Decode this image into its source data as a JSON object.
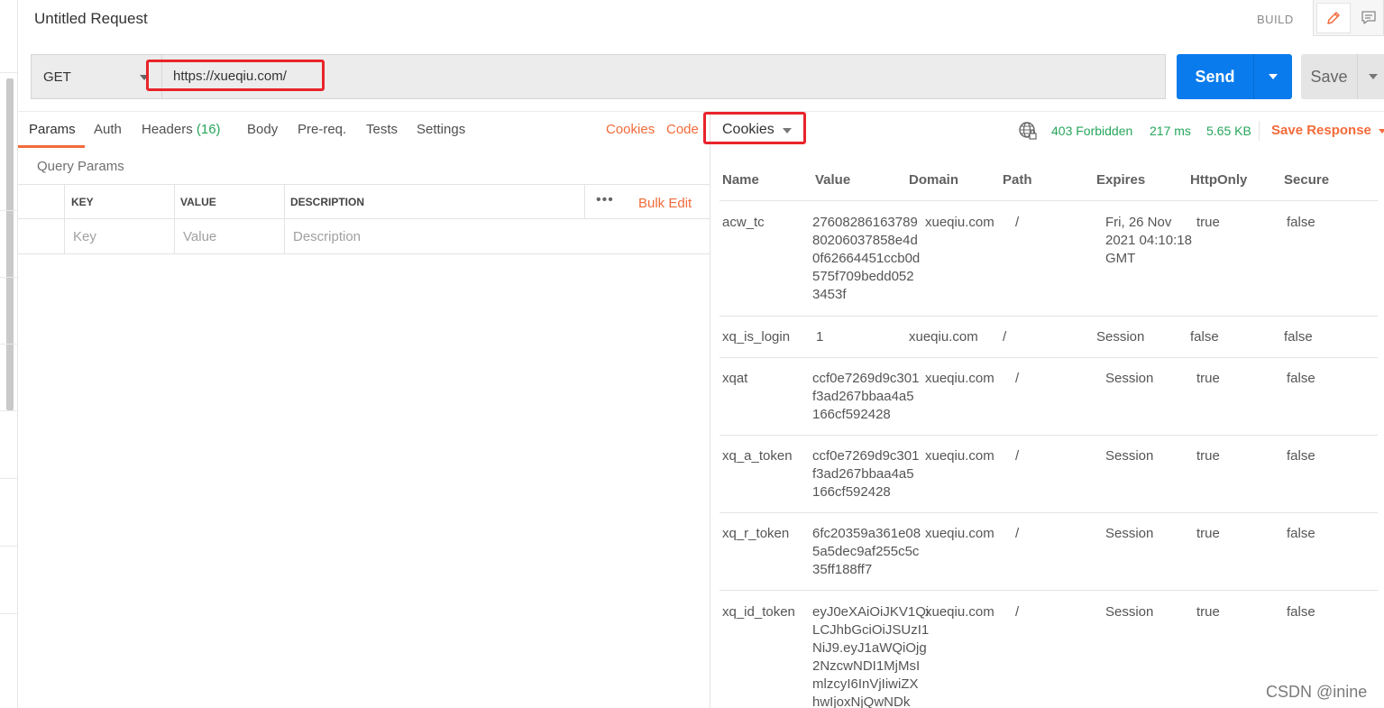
{
  "header": {
    "title": "Untitled Request",
    "build_label": "BUILD"
  },
  "request": {
    "method": "GET",
    "url": "https://xueqiu.com/",
    "send_label": "Send",
    "save_label": "Save"
  },
  "request_tabs": {
    "params": "Params",
    "auth": "Auth",
    "headers": "Headers",
    "headers_count": "(16)",
    "body": "Body",
    "prereq": "Pre-req.",
    "tests": "Tests",
    "settings": "Settings",
    "cookies_link": "Cookies",
    "code_link": "Code"
  },
  "query_params": {
    "title": "Query Params",
    "columns": [
      "KEY",
      "VALUE",
      "DESCRIPTION"
    ],
    "placeholders": [
      "Key",
      "Value",
      "Description"
    ],
    "bulk_edit": "Bulk Edit"
  },
  "response": {
    "tab_label": "Cookies",
    "status": "403 Forbidden",
    "time": "217 ms",
    "size": "5.65 KB",
    "save_response": "Save Response",
    "accent_color": "#f26b3a",
    "status_color": "#26a65b"
  },
  "cookies": {
    "columns": [
      "Name",
      "Value",
      "Domain",
      "Path",
      "Expires",
      "HttpOnly",
      "Secure"
    ],
    "rows": [
      {
        "name": "acw_tc",
        "value": "27608286163789\n80206037858e4d\n0f62664451ccb0d\n575f709bedd052\n3453f",
        "domain": "xueqiu.com",
        "path": "/",
        "expires": "Fri, 26 Nov\n2021 04:10:18\nGMT",
        "httponly": "true",
        "secure": "false"
      },
      {
        "name": "xq_is_login",
        "value": "1",
        "domain": "xueqiu.com",
        "path": "/",
        "expires": "Session",
        "httponly": "false",
        "secure": "false"
      },
      {
        "name": "xqat",
        "value": "ccf0e7269d9c301\nf3ad267bbaa4a5\n166cf592428",
        "domain": "xueqiu.com",
        "path": "/",
        "expires": "Session",
        "httponly": "true",
        "secure": "false"
      },
      {
        "name": "xq_a_token",
        "value": "ccf0e7269d9c301\nf3ad267bbaa4a5\n166cf592428",
        "domain": "xueqiu.com",
        "path": "/",
        "expires": "Session",
        "httponly": "true",
        "secure": "false"
      },
      {
        "name": "xq_r_token",
        "value": "6fc20359a361e08\n5a5dec9af255c5c\n35ff188ff7",
        "domain": "xueqiu.com",
        "path": "/",
        "expires": "Session",
        "httponly": "true",
        "secure": "false"
      },
      {
        "name": "xq_id_token",
        "value": "eyJ0eXAiOiJKV1Qi\nLCJhbGciOiJSUzI1\nNiJ9.eyJ1aWQiOjg\n2NzcwNDI1MjMsI\nmlzcyI6InVjIiwiZX\nhwIjoxNjQwNDk",
        "domain": "xueqiu.com",
        "path": "/",
        "expires": "Session",
        "httponly": "true",
        "secure": "false"
      }
    ]
  },
  "watermark": "CSDN @inine"
}
